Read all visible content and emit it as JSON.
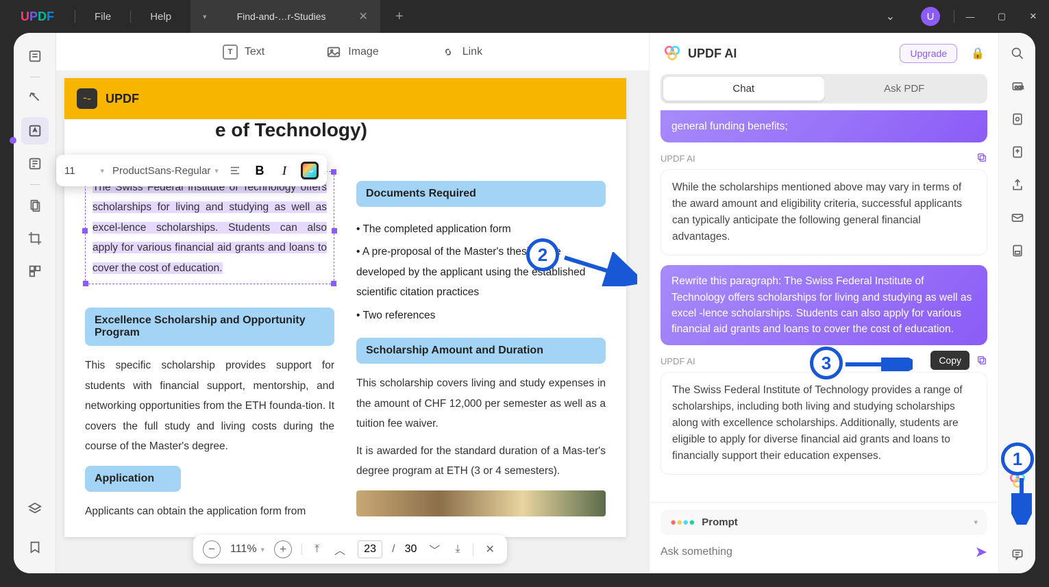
{
  "titlebar": {
    "menus": {
      "file": "File",
      "help": "Help"
    },
    "tab": {
      "name": "Find-and-…r-Studies"
    },
    "avatar": "U"
  },
  "top_tools": {
    "text": "Text",
    "image": "Image",
    "link": "Link"
  },
  "edit_toolbar": {
    "font_size": "11",
    "font_family": "ProductSans-Regular"
  },
  "page": {
    "brand": "UPDF",
    "title": "e of Technology)",
    "sel_text": "The Swiss Federal Institute of Technology offers scholarships for living and studying as well as excel-lence scholarships. Students can also apply for various financial aid grants and loans to cover the cost of education.",
    "h1": "Excellence Scholarship and Opportunity Program",
    "p1": "This specific scholarship provides support for students with financial support, mentorship, and networking opportunities from the ETH founda-tion. It covers the full study and living costs during the course of the Master's degree.",
    "h2": "Application",
    "p2": "Applicants can obtain the application form from",
    "hR1": "Documents Required",
    "bR1": "• The completed application form",
    "bR2": "• A pre-proposal of the Master's thesis to be developed by the applicant using the established scientific citation practices",
    "bR3": "• Two references",
    "hR2": "Scholarship Amount and Duration",
    "pR1": "This scholarship covers living and study expenses in the amount of CHF 12,000 per semester as well as a tuition fee waiver.",
    "pR2": "It is awarded for the standard duration of a Mas-ter's degree program at ETH (3 or 4 semesters)."
  },
  "bottom_nav": {
    "zoom": "111%",
    "page": "23",
    "total": "30"
  },
  "ai": {
    "title": "UPDF AI",
    "upgrade": "Upgrade",
    "tabs": {
      "chat": "Chat",
      "ask_pdf": "Ask PDF"
    },
    "msg_user_top": "general funding benefits;",
    "label": "UPDF AI",
    "msg_ai_1": "While the scholarships mentioned above may vary in terms of the award amount and eligibility criteria, successful applicants can typically anticipate the following general financial advantages.",
    "msg_user_2": "Rewrite this paragraph: The Swiss Federal Institute of Technology offers scholarships for living and studying as well as excel -lence scholarships. Students can also apply for various financial aid grants and loans to cover the cost of education.",
    "msg_ai_2": "The Swiss Federal Institute of Technology provides a range of scholarships, including both living and studying scholarships along with excellence scholarships. Additionally, students are eligible to apply for diverse financial aid grants and loans to financially support their education expenses.",
    "copy_tip": "Copy",
    "prompt": "Prompt",
    "ask_placeholder": "Ask something"
  }
}
